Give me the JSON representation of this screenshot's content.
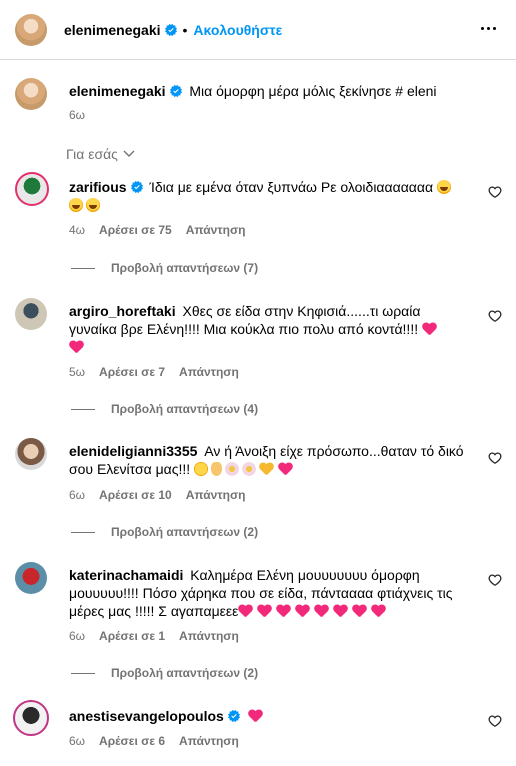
{
  "header": {
    "username": "elenimenegaki",
    "separator": "•",
    "follow_label": "Ακολουθήστε",
    "more_icon": "more-horizontal-icon"
  },
  "caption": {
    "username": "elenimenegaki",
    "text": "Μια όμορφη μέρα μόλις ξεκίνησε # eleni",
    "time": "6ω"
  },
  "sort": {
    "label": "Για εσάς"
  },
  "colors": {
    "link": "#0095f6",
    "secondary": "#737373",
    "verified": "#0095f6",
    "heart_emoji": "#f2297a"
  },
  "comments": [
    {
      "username": "zarifious",
      "verified": true,
      "text": "Ίδια με εμένα όταν ξυπνάω Ρε ολοιδιααααααα",
      "emojis": [
        "laughing-emoji",
        "laughing-emoji",
        "laughing-emoji"
      ],
      "time": "4ω",
      "likes": "Αρέσει σε 75",
      "reply": "Απάντηση",
      "view_replies": "Προβολή απαντήσεων (7)"
    },
    {
      "username": "argiro_horeftaki",
      "verified": false,
      "text": "Χθες σε είδα στην Κηφισιά......τι ωραία γυναίκα βρε Ελένη!!!! Μια κούκλα πιο πολυ από κοντά!!!!",
      "emojis": [
        "pink-heart-emoji",
        "pink-heart-emoji"
      ],
      "time": "5ω",
      "likes": "Αρέσει σε 7",
      "reply": "Απάντηση",
      "view_replies": "Προβολή απαντήσεων (4)"
    },
    {
      "username": "elenideligianni3355",
      "verified": false,
      "text": "Αν ή Άνοιξη είχε πρόσωπο...θαταν τό δικό σου Ελενίτσα μας!!!",
      "emojis": [
        "smiling-emoji",
        "ok-hand-emoji",
        "blossom-emoji",
        "blossom-emoji",
        "yellow-heart-emoji",
        "pink-heart-emoji"
      ],
      "time": "6ω",
      "likes": "Αρέσει σε 10",
      "reply": "Απάντηση",
      "view_replies": "Προβολή απαντήσεων (2)"
    },
    {
      "username": "katerinachamaidi",
      "verified": false,
      "text": "Καλημέρα Ελένη μουυυυυυυ όμορφη μουυυυυ!!!! Πόσο χάρηκα που σε είδα, πάνταααα φτιάχνεις τις μέρες μας !!!!! Σ αγαπαμεεε",
      "emojis": [
        "pink-heart-emoji",
        "pink-heart-emoji",
        "pink-heart-emoji",
        "pink-heart-emoji",
        "pink-heart-emoji",
        "pink-heart-emoji",
        "pink-heart-emoji",
        "pink-heart-emoji"
      ],
      "time": "6ω",
      "likes": "Αρέσει σε 1",
      "reply": "Απάντηση",
      "view_replies": "Προβολή απαντήσεων (2)"
    },
    {
      "username": "anestisevangelopoulos",
      "verified": true,
      "text": "",
      "emojis": [
        "pink-heart-emoji"
      ],
      "time": "6ω",
      "likes": "Αρέσει σε 6",
      "reply": "Απάντηση",
      "view_replies": ""
    }
  ]
}
